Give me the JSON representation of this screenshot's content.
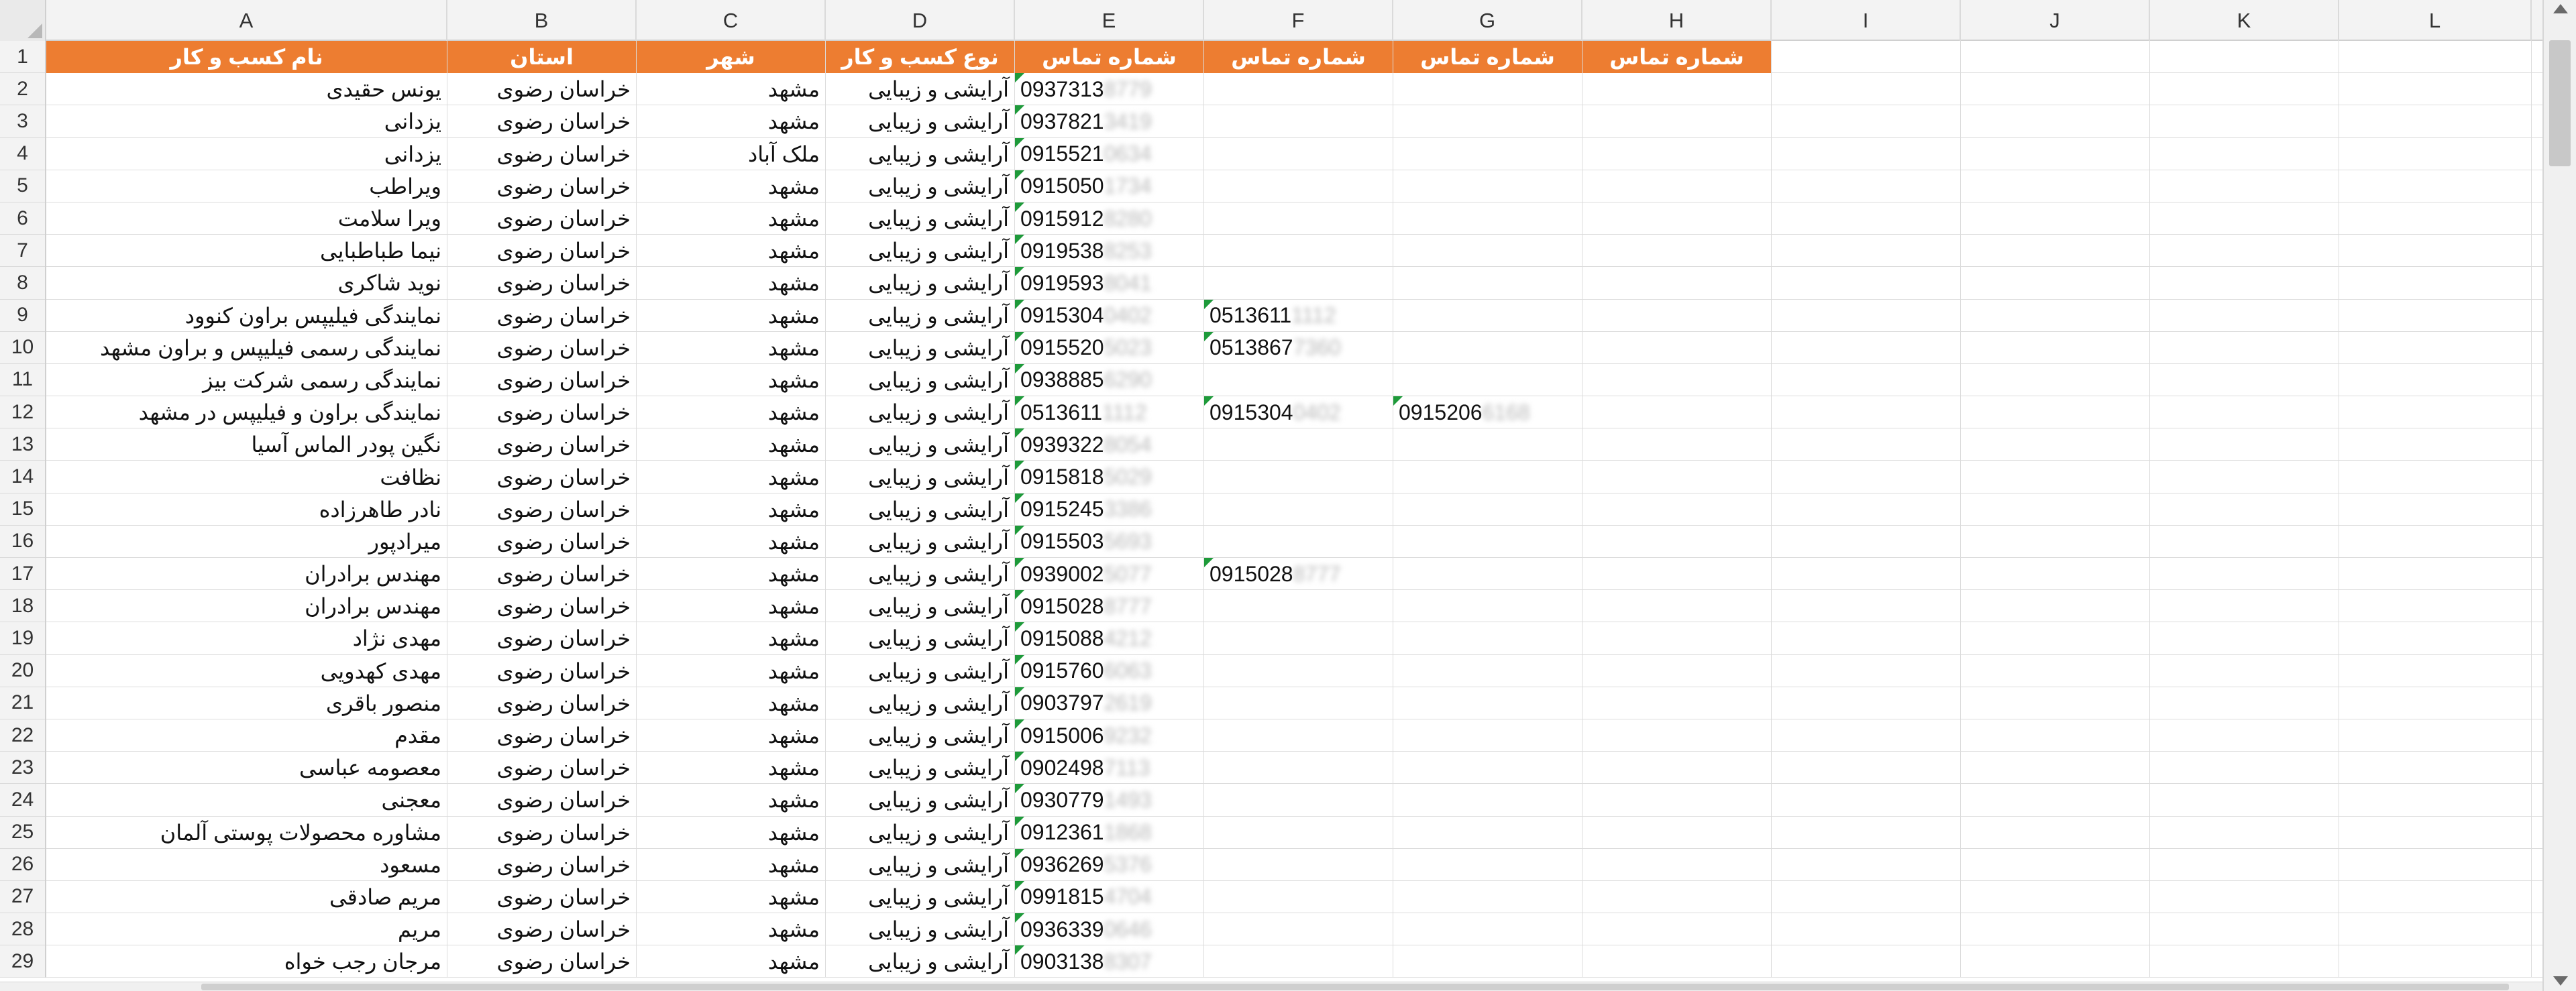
{
  "column_letters": [
    "A",
    "B",
    "C",
    "D",
    "E",
    "F",
    "G",
    "H",
    "I",
    "J",
    "K",
    "L"
  ],
  "header_row": [
    "نام کسب و کار",
    "استان",
    "شهر",
    "نوع کسب و کار",
    "شماره تماس",
    "شماره تماس",
    "شماره تماس",
    "شماره تماس",
    "",
    "",
    "",
    ""
  ],
  "header_color": "#ed7d31",
  "rows": [
    {
      "num": "2",
      "name": "یونس حقیدی",
      "province": "خراسان رضوی",
      "city": "مشهد",
      "type": "آرایشی و زیبایی",
      "e": "0937313",
      "e_hidden": "8779",
      "f": "",
      "f_hidden": "",
      "g": "",
      "g_hidden": ""
    },
    {
      "num": "3",
      "name": "یزدانی",
      "province": "خراسان رضوی",
      "city": "مشهد",
      "type": "آرایشی و زیبایی",
      "e": "0937821",
      "e_hidden": "3419",
      "f": "",
      "f_hidden": "",
      "g": "",
      "g_hidden": ""
    },
    {
      "num": "4",
      "name": "یزدانی",
      "province": "خراسان رضوی",
      "city": "ملک آباد",
      "type": "آرایشی و زیبایی",
      "e": "0915521",
      "e_hidden": "0634",
      "f": "",
      "f_hidden": "",
      "g": "",
      "g_hidden": ""
    },
    {
      "num": "5",
      "name": "ویراطب",
      "province": "خراسان رضوی",
      "city": "مشهد",
      "type": "آرایشی و زیبایی",
      "e": "0915050",
      "e_hidden": "1734",
      "f": "",
      "f_hidden": "",
      "g": "",
      "g_hidden": ""
    },
    {
      "num": "6",
      "name": "ویرا سلامت",
      "province": "خراسان رضوی",
      "city": "مشهد",
      "type": "آرایشی و زیبایی",
      "e": "0915912",
      "e_hidden": "8280",
      "f": "",
      "f_hidden": "",
      "g": "",
      "g_hidden": ""
    },
    {
      "num": "7",
      "name": "نیما طباطبایی",
      "province": "خراسان رضوی",
      "city": "مشهد",
      "type": "آرایشی و زیبایی",
      "e": "0919538",
      "e_hidden": "8253",
      "f": "",
      "f_hidden": "",
      "g": "",
      "g_hidden": ""
    },
    {
      "num": "8",
      "name": "نوید شاکری",
      "province": "خراسان رضوی",
      "city": "مشهد",
      "type": "آرایشی و زیبایی",
      "e": "0919593",
      "e_hidden": "8041",
      "f": "",
      "f_hidden": "",
      "g": "",
      "g_hidden": ""
    },
    {
      "num": "9",
      "name": "نمایندگی فیلیپس براون کنوود",
      "province": "خراسان رضوی",
      "city": "مشهد",
      "type": "آرایشی و زیبایی",
      "e": "0915304",
      "e_hidden": "0402",
      "f": "0513611",
      "f_hidden": "1112",
      "g": "",
      "g_hidden": ""
    },
    {
      "num": "10",
      "name": "نمایندگی رسمی فیلیپس و براون مشهد",
      "province": "خراسان رضوی",
      "city": "مشهد",
      "type": "آرایشی و زیبایی",
      "e": "0915520",
      "e_hidden": "5023",
      "f": "0513867",
      "f_hidden": "7360",
      "g": "",
      "g_hidden": ""
    },
    {
      "num": "11",
      "name": "نمایندگی رسمی شرکت بیز",
      "province": "خراسان رضوی",
      "city": "مشهد",
      "type": "آرایشی و زیبایی",
      "e": "0938885",
      "e_hidden": "6290",
      "f": "",
      "f_hidden": "",
      "g": "",
      "g_hidden": ""
    },
    {
      "num": "12",
      "name": "نمایندگی براون و فیلیپس در مشهد",
      "province": "خراسان رضوی",
      "city": "مشهد",
      "type": "آرایشی و زیبایی",
      "e": "0513611",
      "e_hidden": "1112",
      "f": "0915304",
      "f_hidden": "0402",
      "g": "0915206",
      "g_hidden": "6168"
    },
    {
      "num": "13",
      "name": "نگین پودر الماس آسیا",
      "province": "خراسان رضوی",
      "city": "مشهد",
      "type": "آرایشی و زیبایی",
      "e": "0939322",
      "e_hidden": "8054",
      "f": "",
      "f_hidden": "",
      "g": "",
      "g_hidden": ""
    },
    {
      "num": "14",
      "name": "نظافت",
      "province": "خراسان رضوی",
      "city": "مشهد",
      "type": "آرایشی و زیبایی",
      "e": "0915818",
      "e_hidden": "5029",
      "f": "",
      "f_hidden": "",
      "g": "",
      "g_hidden": ""
    },
    {
      "num": "15",
      "name": "نادر طاهرزاده",
      "province": "خراسان رضوی",
      "city": "مشهد",
      "type": "آرایشی و زیبایی",
      "e": "0915245",
      "e_hidden": "3386",
      "f": "",
      "f_hidden": "",
      "g": "",
      "g_hidden": ""
    },
    {
      "num": "16",
      "name": "میرادپور",
      "province": "خراسان رضوی",
      "city": "مشهد",
      "type": "آرایشی و زیبایی",
      "e": "0915503",
      "e_hidden": "5693",
      "f": "",
      "f_hidden": "",
      "g": "",
      "g_hidden": ""
    },
    {
      "num": "17",
      "name": "مهندس برادران",
      "province": "خراسان رضوی",
      "city": "مشهد",
      "type": "آرایشی و زیبایی",
      "e": "0939002",
      "e_hidden": "5077",
      "f": "0915028",
      "f_hidden": "8777",
      "g": "",
      "g_hidden": ""
    },
    {
      "num": "18",
      "name": "مهندس برادران",
      "province": "خراسان رضوی",
      "city": "مشهد",
      "type": "آرایشی و زیبایی",
      "e": "0915028",
      "e_hidden": "8777",
      "f": "",
      "f_hidden": "",
      "g": "",
      "g_hidden": ""
    },
    {
      "num": "19",
      "name": "مهدی نژاد",
      "province": "خراسان رضوی",
      "city": "مشهد",
      "type": "آرایشی و زیبایی",
      "e": "0915088",
      "e_hidden": "4212",
      "f": "",
      "f_hidden": "",
      "g": "",
      "g_hidden": ""
    },
    {
      "num": "20",
      "name": "مهدی کهدویی",
      "province": "خراسان رضوی",
      "city": "مشهد",
      "type": "آرایشی و زیبایی",
      "e": "0915760",
      "e_hidden": "6063",
      "f": "",
      "f_hidden": "",
      "g": "",
      "g_hidden": ""
    },
    {
      "num": "21",
      "name": "منصور باقری",
      "province": "خراسان رضوی",
      "city": "مشهد",
      "type": "آرایشی و زیبایی",
      "e": "0903797",
      "e_hidden": "2619",
      "f": "",
      "f_hidden": "",
      "g": "",
      "g_hidden": ""
    },
    {
      "num": "22",
      "name": "مقدم",
      "province": "خراسان رضوی",
      "city": "مشهد",
      "type": "آرایشی و زیبایی",
      "e": "0915006",
      "e_hidden": "9232",
      "f": "",
      "f_hidden": "",
      "g": "",
      "g_hidden": ""
    },
    {
      "num": "23",
      "name": "معصومه عباسی",
      "province": "خراسان رضوی",
      "city": "مشهد",
      "type": "آرایشی و زیبایی",
      "e": "0902498",
      "e_hidden": "7113",
      "f": "",
      "f_hidden": "",
      "g": "",
      "g_hidden": ""
    },
    {
      "num": "24",
      "name": "معجنی",
      "province": "خراسان رضوی",
      "city": "مشهد",
      "type": "آرایشی و زیبایی",
      "e": "0930779",
      "e_hidden": "1493",
      "f": "",
      "f_hidden": "",
      "g": "",
      "g_hidden": ""
    },
    {
      "num": "25",
      "name": "مشاوره محصولات پوستی آلمان",
      "province": "خراسان رضوی",
      "city": "مشهد",
      "type": "آرایشی و زیبایی",
      "e": "0912361",
      "e_hidden": "1868",
      "f": "",
      "f_hidden": "",
      "g": "",
      "g_hidden": ""
    },
    {
      "num": "26",
      "name": "مسعود",
      "province": "خراسان رضوی",
      "city": "مشهد",
      "type": "آرایشی و زیبایی",
      "e": "0936269",
      "e_hidden": "5376",
      "f": "",
      "f_hidden": "",
      "g": "",
      "g_hidden": ""
    },
    {
      "num": "27",
      "name": "مریم صادقی",
      "province": "خراسان رضوی",
      "city": "مشهد",
      "type": "آرایشی و زیبایی",
      "e": "0991815",
      "e_hidden": "4704",
      "f": "",
      "f_hidden": "",
      "g": "",
      "g_hidden": ""
    },
    {
      "num": "28",
      "name": "مریم",
      "province": "خراسان رضوی",
      "city": "مشهد",
      "type": "آرایشی و زیبایی",
      "e": "0936339",
      "e_hidden": "0646",
      "f": "",
      "f_hidden": "",
      "g": "",
      "g_hidden": ""
    },
    {
      "num": "29",
      "name": "مرجان رجب خواه",
      "province": "خراسان رضوی",
      "city": "مشهد",
      "type": "آرایشی و زیبایی",
      "e": "0903138",
      "e_hidden": "8307",
      "f": "",
      "f_hidden": "",
      "g": "",
      "g_hidden": ""
    }
  ]
}
